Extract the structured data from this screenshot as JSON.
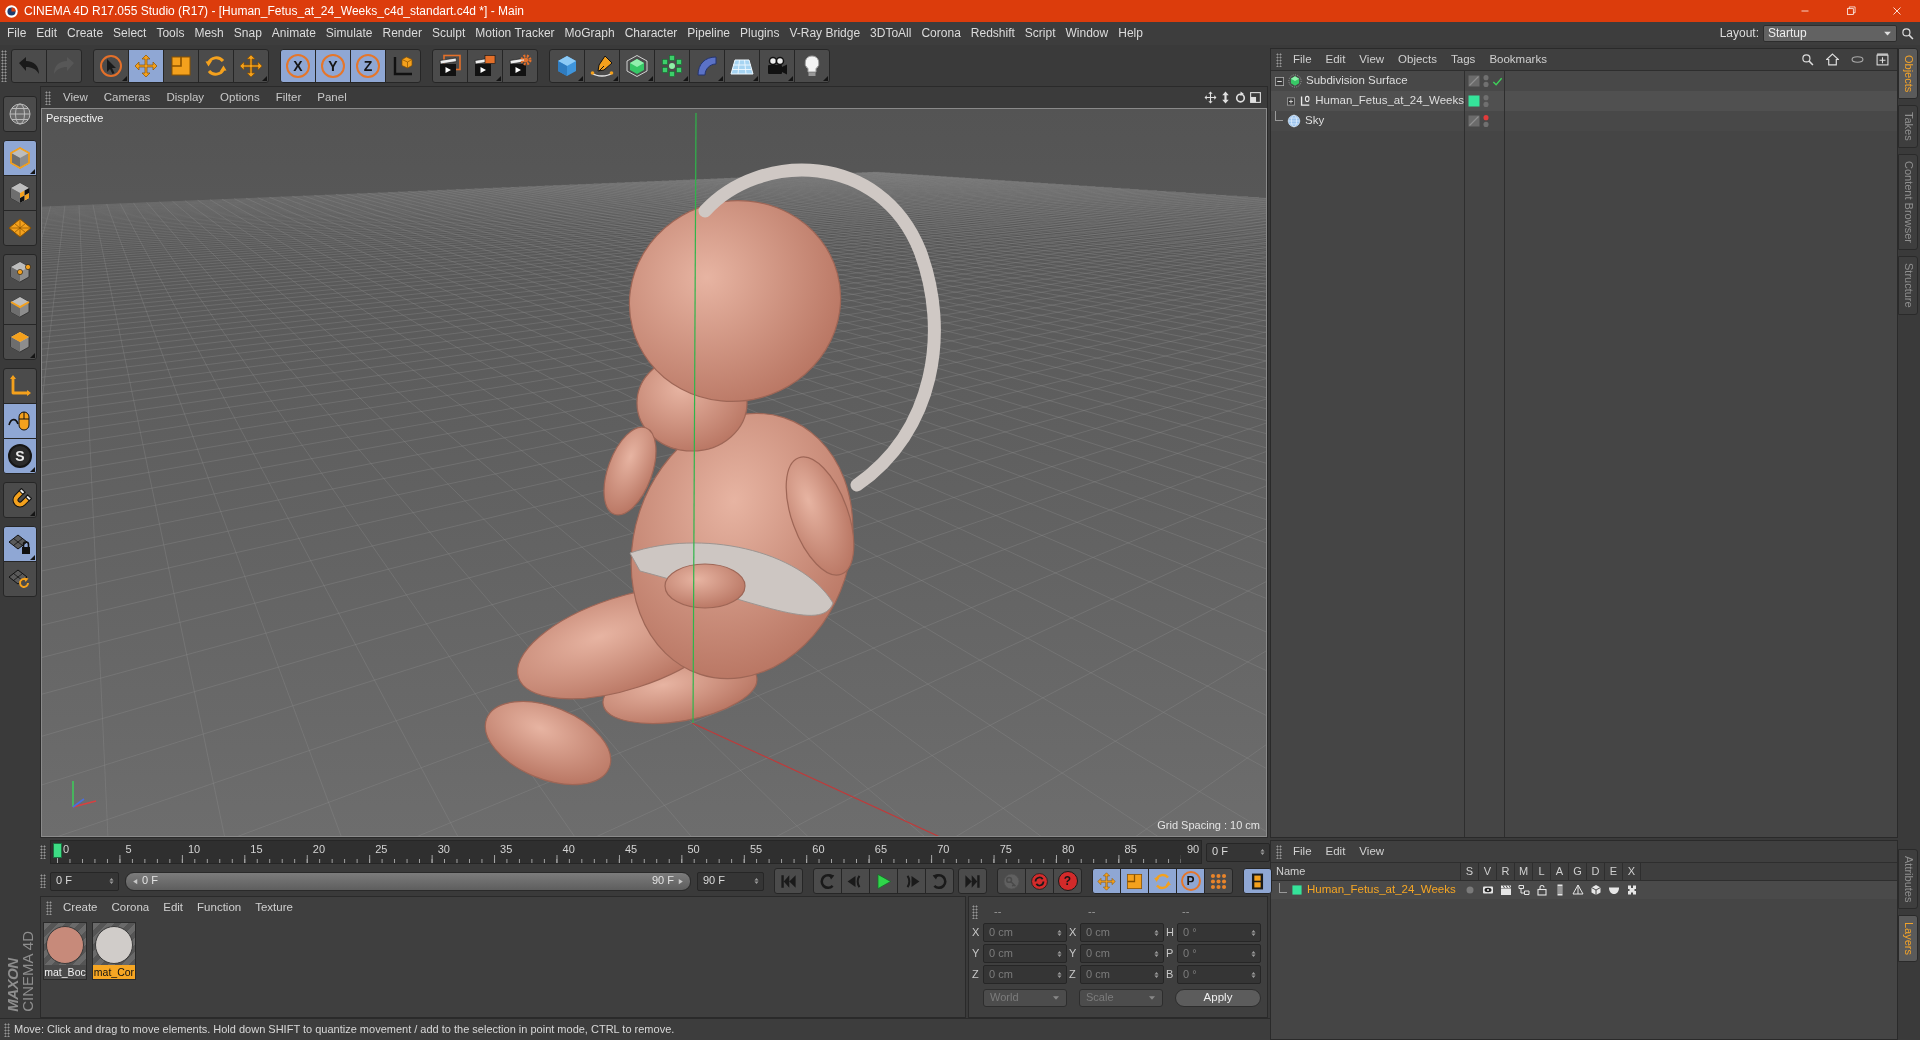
{
  "window": {
    "title": "CINEMA 4D R17.055 Studio (R17) - [Human_Fetus_at_24_Weeks_c4d_standart.c4d *] - Main"
  },
  "menu_bar": {
    "items": [
      "File",
      "Edit",
      "Create",
      "Select",
      "Tools",
      "Mesh",
      "Snap",
      "Animate",
      "Simulate",
      "Render",
      "Sculpt",
      "Motion Tracker",
      "MoGraph",
      "Character",
      "Pipeline",
      "Plugins",
      "V-Ray Bridge",
      "3DToAll",
      "Corona",
      "Redshift",
      "Script",
      "Window",
      "Help"
    ],
    "layout_label": "Layout:",
    "layout_value": "Startup"
  },
  "toolbar": {
    "groups": [
      [
        {
          "kind": "undo",
          "selected": false,
          "disabled": false,
          "submenu": false
        },
        {
          "kind": "redo",
          "selected": false,
          "disabled": true,
          "submenu": false
        }
      ],
      [
        {
          "kind": "select",
          "selected": false,
          "disabled": false,
          "submenu": true
        },
        {
          "kind": "move",
          "selected": true,
          "disabled": false,
          "submenu": false
        },
        {
          "kind": "scale",
          "selected": false,
          "disabled": false,
          "submenu": false
        },
        {
          "kind": "rotate",
          "selected": false,
          "disabled": false,
          "submenu": false
        },
        {
          "kind": "multi-move",
          "selected": false,
          "disabled": false,
          "submenu": true
        }
      ],
      [
        {
          "kind": "axis-lock",
          "label": "X",
          "selected": true,
          "disabled": false,
          "submenu": false
        },
        {
          "kind": "axis-lock",
          "label": "Y",
          "selected": true,
          "disabled": false,
          "submenu": false
        },
        {
          "kind": "axis-lock",
          "label": "Z",
          "selected": true,
          "disabled": false,
          "submenu": false
        },
        {
          "kind": "coordinate-system",
          "selected": false,
          "disabled": false,
          "submenu": false
        }
      ],
      [
        {
          "kind": "render-view",
          "selected": false,
          "disabled": false,
          "submenu": false
        },
        {
          "kind": "render-picture-viewer",
          "selected": false,
          "disabled": false,
          "submenu": true
        },
        {
          "kind": "render-settings",
          "selected": false,
          "disabled": false,
          "submenu": false
        }
      ],
      [
        {
          "kind": "cube",
          "selected": false,
          "disabled": false,
          "submenu": true
        },
        {
          "kind": "pen",
          "selected": false,
          "disabled": false,
          "submenu": true
        },
        {
          "kind": "subdivision",
          "selected": false,
          "disabled": false,
          "submenu": true
        },
        {
          "kind": "cloner",
          "selected": false,
          "disabled": false,
          "submenu": true
        },
        {
          "kind": "bend",
          "selected": false,
          "disabled": false,
          "submenu": true
        },
        {
          "kind": "floor",
          "selected": false,
          "disabled": false,
          "submenu": true
        },
        {
          "kind": "camera",
          "selected": false,
          "disabled": false,
          "submenu": true
        },
        {
          "kind": "light",
          "selected": false,
          "disabled": false,
          "submenu": true
        }
      ]
    ]
  },
  "tool_palette": {
    "groups": [
      [
        {
          "kind": "make-editable",
          "selected": false,
          "submenu": false
        }
      ],
      [
        {
          "kind": "model",
          "selected": true,
          "submenu": true
        },
        {
          "kind": "texture",
          "selected": false,
          "submenu": false
        },
        {
          "kind": "workplane",
          "selected": false,
          "submenu": false
        }
      ],
      [
        {
          "kind": "points",
          "selected": false,
          "submenu": false
        },
        {
          "kind": "edges",
          "selected": false,
          "submenu": false
        },
        {
          "kind": "polygons",
          "selected": false,
          "submenu": true
        }
      ],
      [
        {
          "kind": "axis",
          "selected": false,
          "submenu": false
        },
        {
          "kind": "tweak",
          "selected": true,
          "submenu": false
        },
        {
          "kind": "snap",
          "label": "S",
          "selected": true,
          "submenu": true
        }
      ],
      [
        {
          "kind": "magnet",
          "selected": false,
          "submenu": true
        }
      ],
      [
        {
          "kind": "workplane-lock",
          "selected": true,
          "submenu": true
        },
        {
          "kind": "grid-sync",
          "selected": false,
          "submenu": false
        }
      ]
    ]
  },
  "logo": {
    "brand": "MAXON",
    "product": "CINEMA 4D"
  },
  "viewport": {
    "menu": [
      "View",
      "Cameras",
      "Display",
      "Options",
      "Filter",
      "Panel"
    ],
    "camera": "Perspective",
    "grid_spacing": "Grid Spacing : 10 cm"
  },
  "timeline": {
    "labels": [
      "0",
      "5",
      "10",
      "15",
      "20",
      "25",
      "30",
      "35",
      "40",
      "45",
      "50",
      "55",
      "60",
      "65",
      "70",
      "75",
      "80",
      "85",
      "90"
    ],
    "playhead": {
      "level": 0
    },
    "frame_field": "0 F"
  },
  "playback": {
    "start_field": "0 F",
    "range": {
      "start": "0 F",
      "end": "90 F",
      "level": 1
    },
    "end_field": "90 F",
    "groups": [
      [
        {
          "kind": "go-start",
          "selected": false,
          "disabled": false
        }
      ],
      [
        {
          "kind": "prev-key",
          "selected": false,
          "disabled": false
        },
        {
          "kind": "prev-frame",
          "selected": false,
          "disabled": false
        },
        {
          "kind": "play",
          "selected": false,
          "disabled": false
        },
        {
          "kind": "next-frame",
          "selected": false,
          "disabled": false
        },
        {
          "kind": "next-key",
          "selected": false,
          "disabled": false
        }
      ],
      [
        {
          "kind": "go-end",
          "selected": false,
          "disabled": false
        }
      ],
      [
        {
          "kind": "record",
          "selected": false,
          "disabled": true
        },
        {
          "kind": "autokey",
          "selected": false,
          "disabled": false
        },
        {
          "kind": "keyframe-selection",
          "label": "?",
          "selected": false,
          "disabled": false
        }
      ],
      [
        {
          "kind": "key-position",
          "selected": true,
          "disabled": false
        },
        {
          "kind": "key-scale",
          "selected": true,
          "disabled": false
        },
        {
          "kind": "key-rotation",
          "selected": true,
          "disabled": false
        },
        {
          "kind": "key-parameter",
          "label": "P",
          "selected": true,
          "disabled": false
        },
        {
          "kind": "key-points",
          "selected": false,
          "disabled": false
        }
      ],
      [
        {
          "kind": "timeline-view",
          "selected": true,
          "disabled": false
        }
      ]
    ]
  },
  "materials": {
    "menu": [
      "Create",
      "Corona",
      "Edit",
      "Function",
      "Texture"
    ],
    "items": [
      {
        "name": "mat_Boc",
        "color": "#c78a7a",
        "selected": false
      },
      {
        "name": "mat_Cor",
        "color": "#d0ccc9",
        "selected": true
      }
    ]
  },
  "coordinates": {
    "headers": [
      "--",
      "--",
      "--"
    ],
    "columns": [
      [
        {
          "axis": "X",
          "value": "0 cm"
        },
        {
          "axis": "Y",
          "value": "0 cm"
        },
        {
          "axis": "Z",
          "value": "0 cm"
        }
      ],
      [
        {
          "axis": "X",
          "value": "0 cm"
        },
        {
          "axis": "Y",
          "value": "0 cm"
        },
        {
          "axis": "Z",
          "value": "0 cm"
        }
      ],
      [
        {
          "axis": "H",
          "value": "0 °"
        },
        {
          "axis": "P",
          "value": "0 °"
        },
        {
          "axis": "B",
          "value": "0 °"
        }
      ]
    ],
    "dropdowns": [
      "World",
      "Scale"
    ],
    "apply": "Apply",
    "disabled": true
  },
  "status_bar": {
    "text": "Move: Click and drag to move elements. Hold down SHIFT to quantize movement / add to the selection in point mode, CTRL to remove."
  },
  "object_manager": {
    "menu": [
      "File",
      "Edit",
      "View",
      "Objects",
      "Tags",
      "Bookmarks"
    ],
    "objects": [
      {
        "name": "Subdivision Surface",
        "kind": "subdivision",
        "expanded": true,
        "enabled": true,
        "selected": false,
        "hidden_in_editor": false,
        "hidden_in_render": false,
        "children": [
          {
            "name": "Human_Fetus_at_24_Weeks",
            "kind": "null",
            "expanded": false,
            "selected": false,
            "color": "#35e39a",
            "hidden_in_editor": false,
            "hidden_in_render": false
          }
        ]
      },
      {
        "name": "Sky",
        "kind": "sky",
        "selected": false,
        "hidden_in_editor": true,
        "hidden_in_render": false
      }
    ]
  },
  "layer_manager": {
    "menu": [
      "File",
      "Edit",
      "View"
    ],
    "columns": [
      "Name",
      "S",
      "V",
      "R",
      "M",
      "L",
      "A",
      "G",
      "D",
      "E",
      "X"
    ],
    "rows": [
      {
        "name": "Human_Fetus_at_24_Weeks",
        "color": "#35e39a",
        "selected": true,
        "flags": [
          {
            "kind": "solo",
            "on": false
          },
          {
            "kind": "view",
            "on": true
          },
          {
            "kind": "render",
            "on": true
          },
          {
            "kind": "manager",
            "on": true
          },
          {
            "kind": "locked",
            "on": false
          },
          {
            "kind": "animation",
            "on": true
          },
          {
            "kind": "generators",
            "on": true
          },
          {
            "kind": "deformers",
            "on": true
          },
          {
            "kind": "expressions",
            "on": true
          },
          {
            "kind": "xrefs",
            "on": true
          }
        ]
      }
    ]
  },
  "side_tabs": {
    "top": [
      {
        "label": "Objects",
        "selected": true
      },
      {
        "label": "Takes",
        "selected": false
      },
      {
        "label": "Content Browser",
        "selected": false
      },
      {
        "label": "Structure",
        "selected": false
      }
    ],
    "bottom": [
      {
        "label": "Attributes",
        "selected": false
      },
      {
        "label": "Layers",
        "selected": true
      }
    ]
  }
}
